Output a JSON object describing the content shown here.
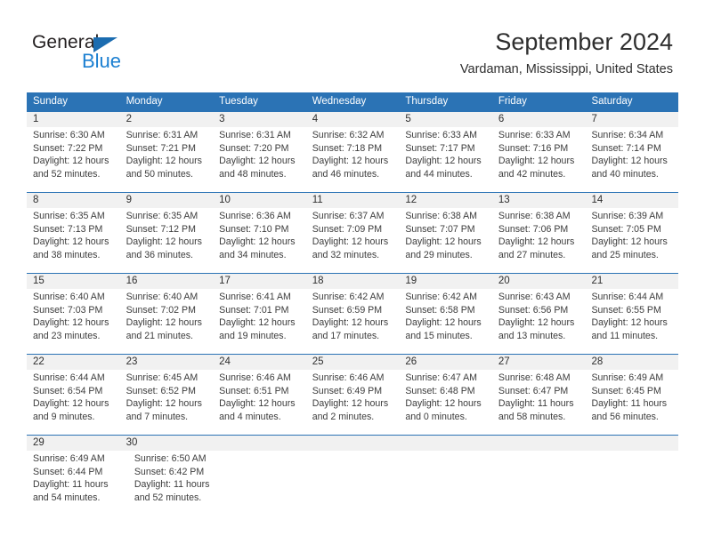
{
  "brand": {
    "name_part1": "General",
    "name_part2": "Blue",
    "accent_dark": "#1b6cb0",
    "accent_light": "#1b7fd1"
  },
  "header": {
    "title": "September 2024",
    "subtitle": "Vardaman, Mississippi, United States"
  },
  "theme": {
    "header_blue": "#2b73b5",
    "daynum_band": "#f1f1f1",
    "text": "#3c3c3c"
  },
  "calendar": {
    "weekday_headers": [
      "Sunday",
      "Monday",
      "Tuesday",
      "Wednesday",
      "Thursday",
      "Friday",
      "Saturday"
    ],
    "weeks": [
      [
        {
          "day": "1",
          "sunrise": "Sunrise: 6:30 AM",
          "sunset": "Sunset: 7:22 PM",
          "daylight_line1": "Daylight: 12 hours",
          "daylight_line2": "and 52 minutes."
        },
        {
          "day": "2",
          "sunrise": "Sunrise: 6:31 AM",
          "sunset": "Sunset: 7:21 PM",
          "daylight_line1": "Daylight: 12 hours",
          "daylight_line2": "and 50 minutes."
        },
        {
          "day": "3",
          "sunrise": "Sunrise: 6:31 AM",
          "sunset": "Sunset: 7:20 PM",
          "daylight_line1": "Daylight: 12 hours",
          "daylight_line2": "and 48 minutes."
        },
        {
          "day": "4",
          "sunrise": "Sunrise: 6:32 AM",
          "sunset": "Sunset: 7:18 PM",
          "daylight_line1": "Daylight: 12 hours",
          "daylight_line2": "and 46 minutes."
        },
        {
          "day": "5",
          "sunrise": "Sunrise: 6:33 AM",
          "sunset": "Sunset: 7:17 PM",
          "daylight_line1": "Daylight: 12 hours",
          "daylight_line2": "and 44 minutes."
        },
        {
          "day": "6",
          "sunrise": "Sunrise: 6:33 AM",
          "sunset": "Sunset: 7:16 PM",
          "daylight_line1": "Daylight: 12 hours",
          "daylight_line2": "and 42 minutes."
        },
        {
          "day": "7",
          "sunrise": "Sunrise: 6:34 AM",
          "sunset": "Sunset: 7:14 PM",
          "daylight_line1": "Daylight: 12 hours",
          "daylight_line2": "and 40 minutes."
        }
      ],
      [
        {
          "day": "8",
          "sunrise": "Sunrise: 6:35 AM",
          "sunset": "Sunset: 7:13 PM",
          "daylight_line1": "Daylight: 12 hours",
          "daylight_line2": "and 38 minutes."
        },
        {
          "day": "9",
          "sunrise": "Sunrise: 6:35 AM",
          "sunset": "Sunset: 7:12 PM",
          "daylight_line1": "Daylight: 12 hours",
          "daylight_line2": "and 36 minutes."
        },
        {
          "day": "10",
          "sunrise": "Sunrise: 6:36 AM",
          "sunset": "Sunset: 7:10 PM",
          "daylight_line1": "Daylight: 12 hours",
          "daylight_line2": "and 34 minutes."
        },
        {
          "day": "11",
          "sunrise": "Sunrise: 6:37 AM",
          "sunset": "Sunset: 7:09 PM",
          "daylight_line1": "Daylight: 12 hours",
          "daylight_line2": "and 32 minutes."
        },
        {
          "day": "12",
          "sunrise": "Sunrise: 6:38 AM",
          "sunset": "Sunset: 7:07 PM",
          "daylight_line1": "Daylight: 12 hours",
          "daylight_line2": "and 29 minutes."
        },
        {
          "day": "13",
          "sunrise": "Sunrise: 6:38 AM",
          "sunset": "Sunset: 7:06 PM",
          "daylight_line1": "Daylight: 12 hours",
          "daylight_line2": "and 27 minutes."
        },
        {
          "day": "14",
          "sunrise": "Sunrise: 6:39 AM",
          "sunset": "Sunset: 7:05 PM",
          "daylight_line1": "Daylight: 12 hours",
          "daylight_line2": "and 25 minutes."
        }
      ],
      [
        {
          "day": "15",
          "sunrise": "Sunrise: 6:40 AM",
          "sunset": "Sunset: 7:03 PM",
          "daylight_line1": "Daylight: 12 hours",
          "daylight_line2": "and 23 minutes."
        },
        {
          "day": "16",
          "sunrise": "Sunrise: 6:40 AM",
          "sunset": "Sunset: 7:02 PM",
          "daylight_line1": "Daylight: 12 hours",
          "daylight_line2": "and 21 minutes."
        },
        {
          "day": "17",
          "sunrise": "Sunrise: 6:41 AM",
          "sunset": "Sunset: 7:01 PM",
          "daylight_line1": "Daylight: 12 hours",
          "daylight_line2": "and 19 minutes."
        },
        {
          "day": "18",
          "sunrise": "Sunrise: 6:42 AM",
          "sunset": "Sunset: 6:59 PM",
          "daylight_line1": "Daylight: 12 hours",
          "daylight_line2": "and 17 minutes."
        },
        {
          "day": "19",
          "sunrise": "Sunrise: 6:42 AM",
          "sunset": "Sunset: 6:58 PM",
          "daylight_line1": "Daylight: 12 hours",
          "daylight_line2": "and 15 minutes."
        },
        {
          "day": "20",
          "sunrise": "Sunrise: 6:43 AM",
          "sunset": "Sunset: 6:56 PM",
          "daylight_line1": "Daylight: 12 hours",
          "daylight_line2": "and 13 minutes."
        },
        {
          "day": "21",
          "sunrise": "Sunrise: 6:44 AM",
          "sunset": "Sunset: 6:55 PM",
          "daylight_line1": "Daylight: 12 hours",
          "daylight_line2": "and 11 minutes."
        }
      ],
      [
        {
          "day": "22",
          "sunrise": "Sunrise: 6:44 AM",
          "sunset": "Sunset: 6:54 PM",
          "daylight_line1": "Daylight: 12 hours",
          "daylight_line2": "and 9 minutes."
        },
        {
          "day": "23",
          "sunrise": "Sunrise: 6:45 AM",
          "sunset": "Sunset: 6:52 PM",
          "daylight_line1": "Daylight: 12 hours",
          "daylight_line2": "and 7 minutes."
        },
        {
          "day": "24",
          "sunrise": "Sunrise: 6:46 AM",
          "sunset": "Sunset: 6:51 PM",
          "daylight_line1": "Daylight: 12 hours",
          "daylight_line2": "and 4 minutes."
        },
        {
          "day": "25",
          "sunrise": "Sunrise: 6:46 AM",
          "sunset": "Sunset: 6:49 PM",
          "daylight_line1": "Daylight: 12 hours",
          "daylight_line2": "and 2 minutes."
        },
        {
          "day": "26",
          "sunrise": "Sunrise: 6:47 AM",
          "sunset": "Sunset: 6:48 PM",
          "daylight_line1": "Daylight: 12 hours",
          "daylight_line2": "and 0 minutes."
        },
        {
          "day": "27",
          "sunrise": "Sunrise: 6:48 AM",
          "sunset": "Sunset: 6:47 PM",
          "daylight_line1": "Daylight: 11 hours",
          "daylight_line2": "and 58 minutes."
        },
        {
          "day": "28",
          "sunrise": "Sunrise: 6:49 AM",
          "sunset": "Sunset: 6:45 PM",
          "daylight_line1": "Daylight: 11 hours",
          "daylight_line2": "and 56 minutes."
        }
      ],
      [
        {
          "day": "29",
          "sunrise": "Sunrise: 6:49 AM",
          "sunset": "Sunset: 6:44 PM",
          "daylight_line1": "Daylight: 11 hours",
          "daylight_line2": "and 54 minutes."
        },
        {
          "day": "30",
          "sunrise": "Sunrise: 6:50 AM",
          "sunset": "Sunset: 6:42 PM",
          "daylight_line1": "Daylight: 11 hours",
          "daylight_line2": "and 52 minutes."
        },
        null,
        null,
        null,
        null,
        null
      ]
    ]
  }
}
